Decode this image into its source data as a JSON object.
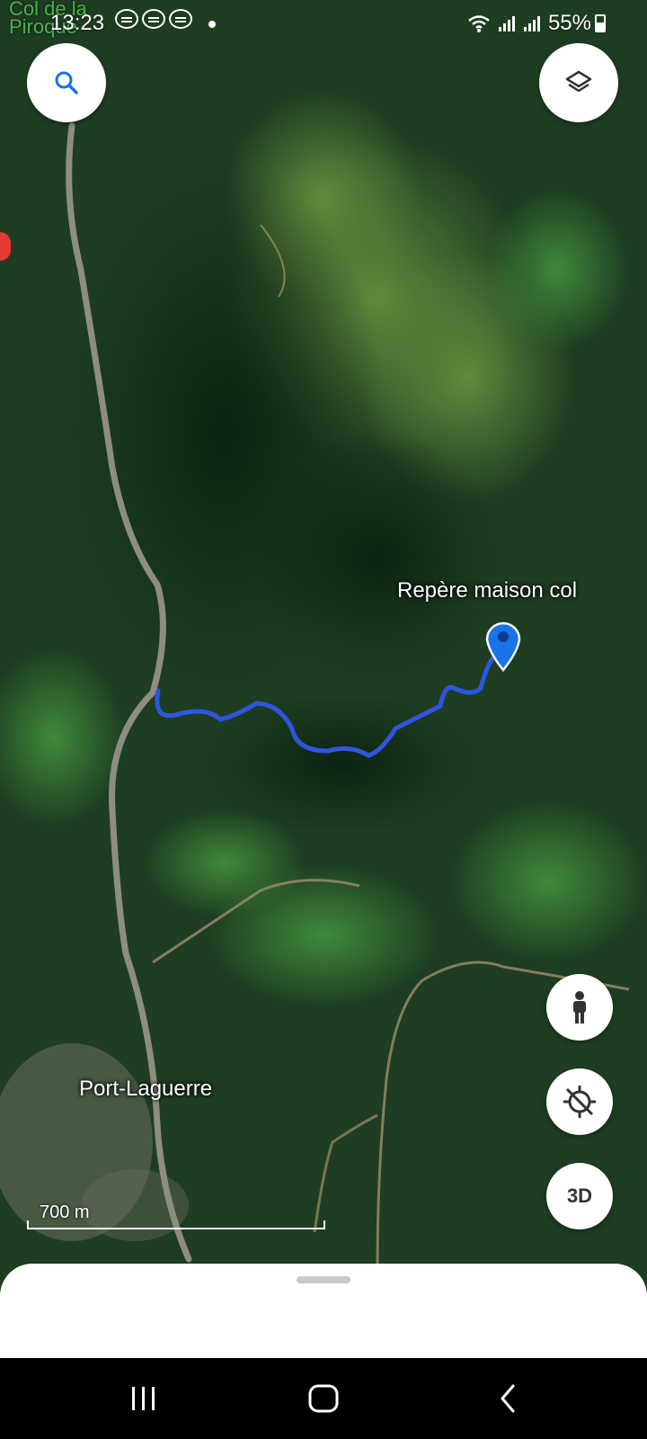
{
  "status_bar": {
    "time": "13:23",
    "battery": "55%",
    "icons": [
      "chat-bubble-icon",
      "chat-bubble-icon",
      "chat-bubble-icon",
      "wifi-icon",
      "signal-icon",
      "signal-icon",
      "battery-icon"
    ]
  },
  "map": {
    "labels": {
      "top_left_place": "Col de la\nPiroque",
      "marker": "Repère maison col",
      "town": "Port-Laguerre"
    },
    "scale": "700 m",
    "route_color": "#2f55e0",
    "marker_color": "#1a73e8"
  },
  "controls": {
    "search": "search-icon",
    "layers": "layers-icon",
    "street_view": "pegman-icon",
    "location": "location-off-icon",
    "view_3d": "3D"
  },
  "nav_bar": {
    "recents": "recents-icon",
    "home": "home-icon",
    "back": "back-icon"
  }
}
